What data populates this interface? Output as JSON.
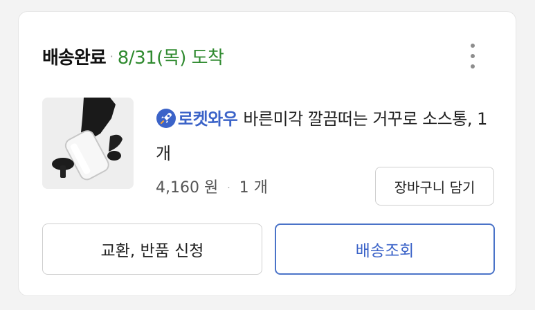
{
  "order": {
    "status": "배송완료",
    "separator": "·",
    "arrival": "8/31(목) 도착"
  },
  "product": {
    "badge": "로켓와우",
    "name": "바른미각 깔끔떠는 거꾸로 소스통, 1개",
    "price": "4,160 원",
    "separator": "·",
    "quantity": "1 개",
    "badge_color": "#3b63c8"
  },
  "actions": {
    "add_to_cart": "장바구니 담기",
    "exchange_return": "교환, 반품 신청",
    "track_delivery": "배송조회"
  },
  "colors": {
    "arrival": "#2f8a2f",
    "primary": "#3b63c8"
  },
  "icons": {
    "more": "more-vertical-icon",
    "badge": "rocket-icon"
  }
}
